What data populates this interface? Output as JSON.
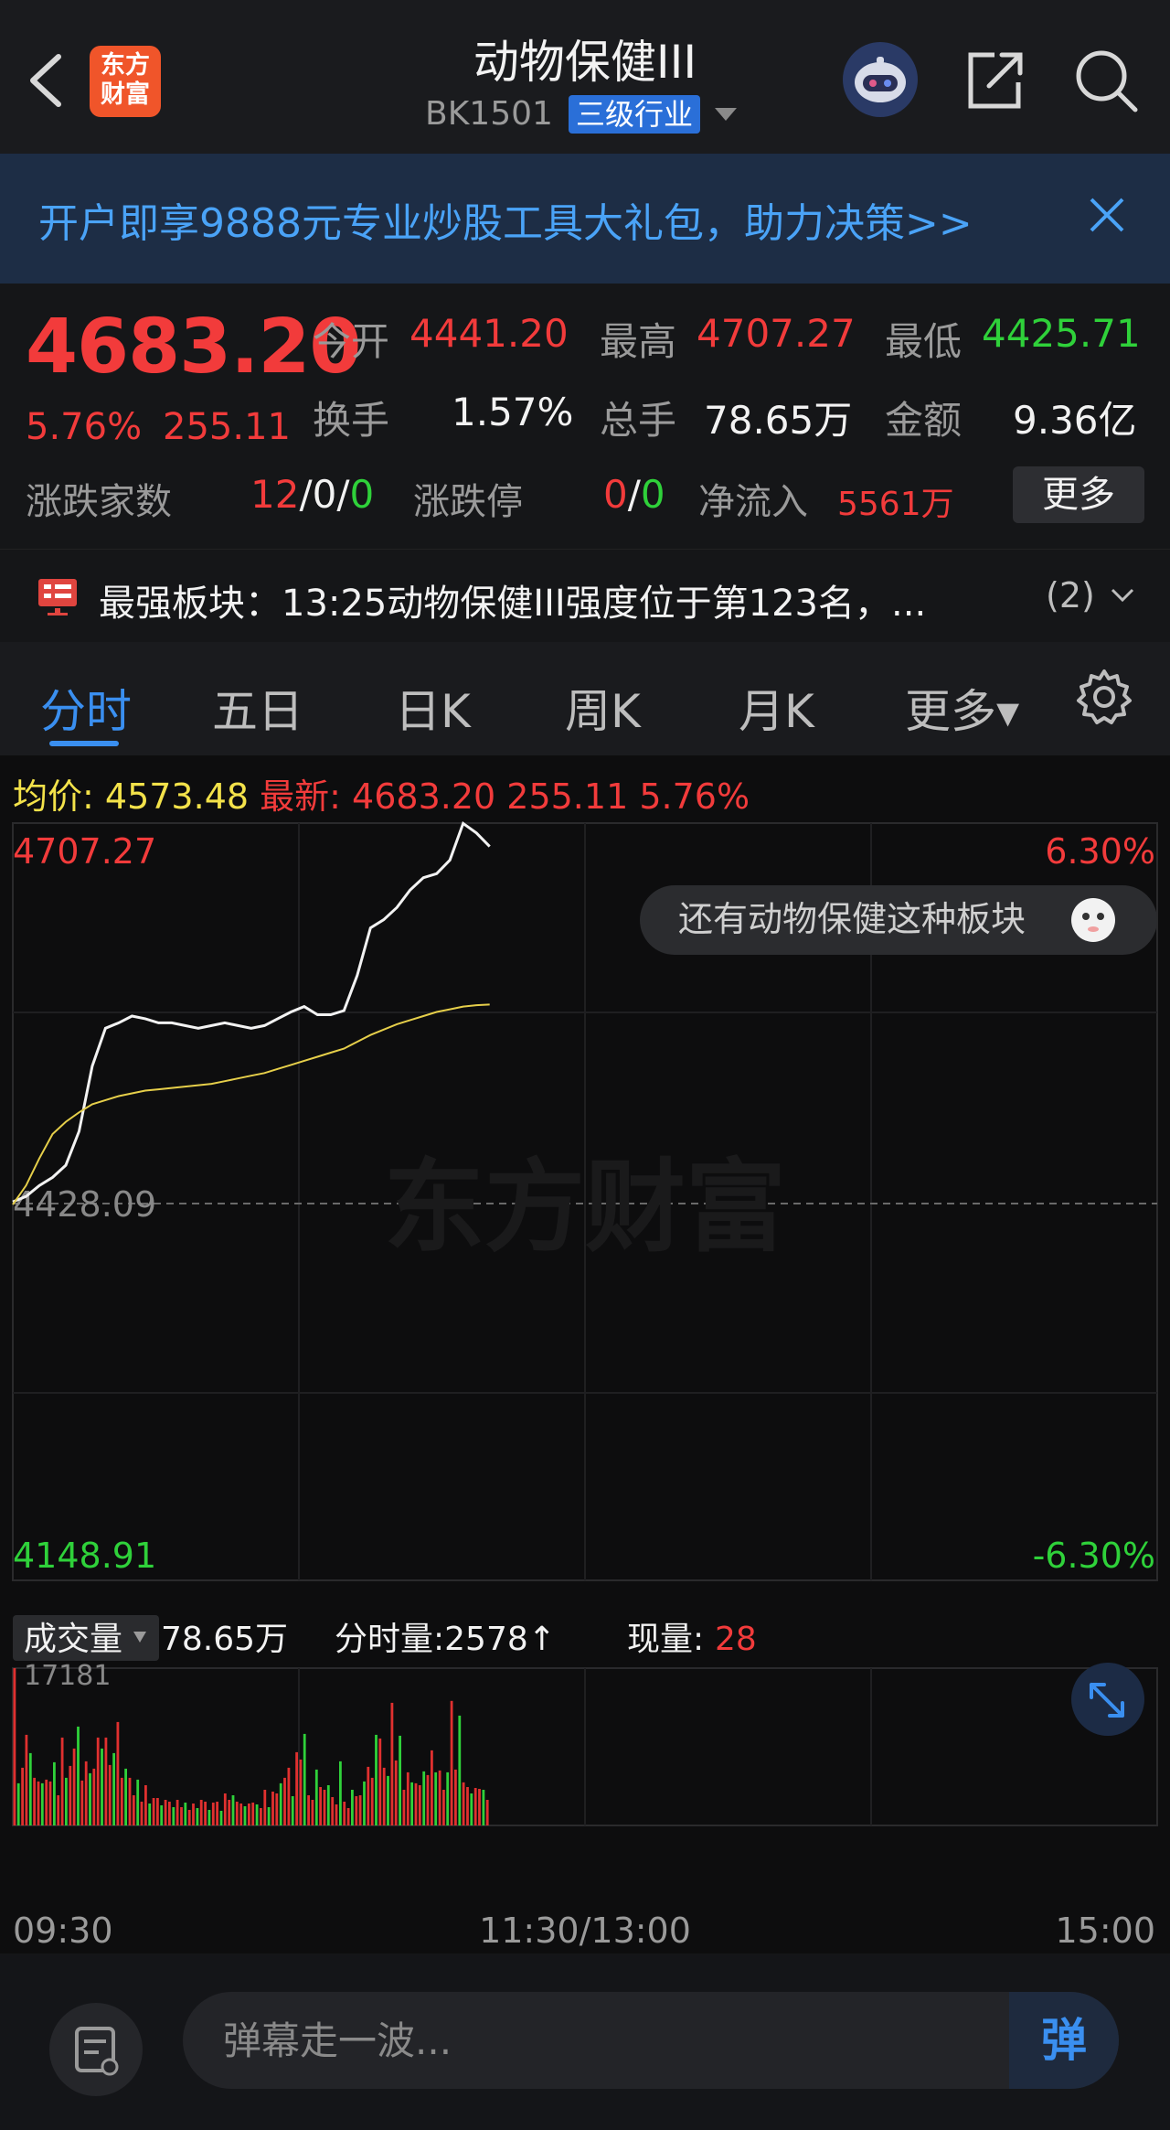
{
  "header": {
    "logo_text": "东方财富",
    "title": "动物保健III",
    "code": "BK1501",
    "badge": "三级行业"
  },
  "banner": {
    "text": "开户即享9888元专业炒股工具大礼包，助力决策>>"
  },
  "quote": {
    "price": "4683.20",
    "pct": "5.76%",
    "change": "255.11",
    "open_label": "今开",
    "open": "4441.20",
    "high_label": "最高",
    "high": "4707.27",
    "low_label": "最低",
    "low": "4425.71",
    "turnover_label": "换手",
    "turnover": "1.57%",
    "volume_label": "总手",
    "volume": "78.65万",
    "amount_label": "金额",
    "amount": "9.36亿",
    "updown_label": "涨跌家数",
    "up": "12",
    "sep1": "/",
    "flat": "0",
    "sep2": "/",
    "down": "0",
    "limit_label": "涨跌停",
    "limit_up": "0",
    "limit_sep": "/",
    "limit_down": "0",
    "inflow_label": "净流入",
    "inflow": "5561万",
    "more_label": "更多"
  },
  "strongest": {
    "text": "最强板块：13:25动物保健III强度位于第123名，...",
    "count": "(2)"
  },
  "tabs": [
    {
      "label": "分时"
    },
    {
      "label": "五日"
    },
    {
      "label": "日K"
    },
    {
      "label": "周K"
    },
    {
      "label": "月K"
    },
    {
      "label": "更多▾"
    }
  ],
  "chart": {
    "avg_label": "均价:",
    "avg": "4573.48",
    "latest_label": "最新:",
    "latest": "4683.20",
    "latest_chg": "255.11",
    "latest_pct": "5.76%",
    "y_top": "4707.27",
    "y_mid": "4428.09",
    "y_bottom": "4148.91",
    "pct_top": "6.30%",
    "pct_bottom": "-6.30%",
    "watermark": "东方财富",
    "tip": "还有动物保健这种板块",
    "vol_label": "成交量",
    "vol_total": "78.65万",
    "minute_vol": "分时量:2578↑",
    "now_label": "现量:",
    "now_val": "28",
    "vol_max": "17181",
    "x_start": "09:30",
    "x_mid": "11:30/13:00",
    "x_end": "15:00"
  },
  "danmaku": {
    "placeholder": "弹幕走一波...",
    "send_label": "弹"
  },
  "chart_data": {
    "type": "line",
    "title": "",
    "ylim": [
      4148.91,
      4707.27
    ],
    "prev_close": 4428.09,
    "series": [
      {
        "values": [
          4428,
          4432,
          4440,
          4446,
          4455,
          4480,
          4528,
          4556,
          4560,
          4565,
          4563,
          4560,
          4560,
          4558,
          4556,
          4558,
          4560,
          4558,
          4556,
          4558,
          4563,
          4568,
          4572,
          4566,
          4566,
          4569,
          4595,
          4630,
          4636,
          4645,
          4658,
          4667,
          4670,
          4680,
          4707,
          4700,
          4690
        ]
      },
      {
        "values": [
          4426,
          4440,
          4460,
          4478,
          4487,
          4494,
          4500,
          4503,
          4506,
          4508,
          4510,
          4511,
          4512,
          4513,
          4514,
          4515,
          4517,
          4519,
          4521,
          4523,
          4526,
          4529,
          4532,
          4535,
          4538,
          4541,
          4546,
          4551,
          4555,
          4559,
          4562,
          4565,
          4568,
          4570,
          4572,
          4573,
          4573.48
        ]
      }
    ],
    "volume": {
      "values": [
        17181,
        4600,
        6300,
        9900,
        7900,
        5200,
        4800,
        4600,
        5000,
        4800,
        6900,
        3300,
        9600,
        5200,
        6500,
        8400,
        10800,
        4900,
        7000,
        5700,
        6200,
        9600,
        8400,
        9600,
        6600,
        7900,
        11300,
        5200,
        6200,
        5200,
        3300,
        5000,
        2600,
        4400,
        2400,
        3000,
        3000,
        2200,
        2800,
        2600,
        2000,
        2800,
        2000,
        2500,
        1700,
        2400,
        1900,
        2800,
        2600,
        1700,
        2500,
        2600,
        1600,
        3500,
        2800,
        3300,
        2600,
        2400,
        2100,
        2400,
        2500,
        2300,
        1900,
        3900,
        2000,
        3700,
        3500,
        4600,
        5200,
        6300,
        3200,
        8000,
        7200,
        10000,
        3300,
        2800,
        6100,
        4200,
        3900,
        4400,
        3100,
        2300,
        7000,
        2600,
        1900,
        3900,
        3200,
        3300,
        4800,
        6400,
        5200,
        9900,
        9500,
        6300,
        5400,
        13400,
        7100,
        9800,
        3900,
        5800,
        4700,
        4600,
        4400,
        5900,
        5500,
        8200,
        5800,
        6000,
        3900,
        5800,
        13600,
        6100,
        12000,
        4700,
        4200,
        3500,
        4100,
        4000,
        3900,
        2800
      ]
    }
  }
}
